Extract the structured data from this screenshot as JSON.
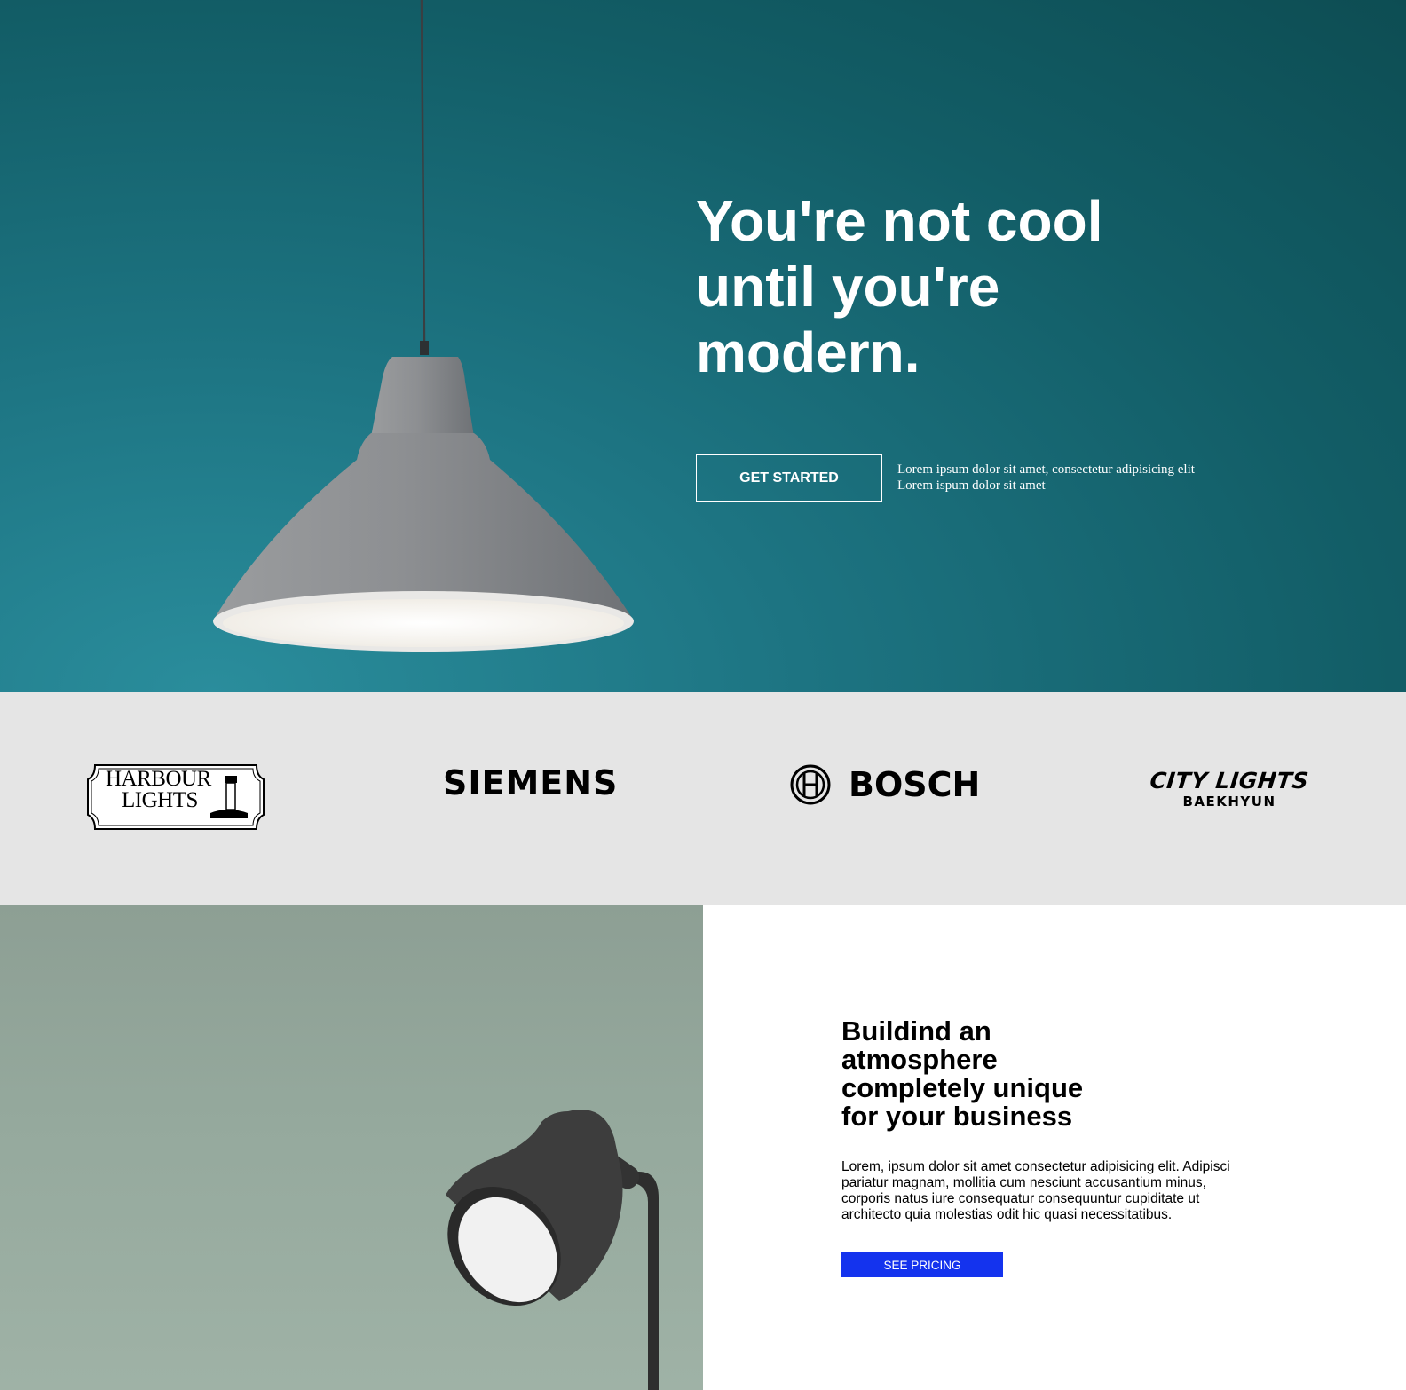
{
  "hero": {
    "title_line1": "You're not cool",
    "title_line2": "until you're",
    "title_line3": "modern.",
    "cta_label": "GET STARTED",
    "note_line1": "Lorem ipsum dolor sit amet, consectetur adipisicing elit",
    "note_line2": "Lorem ispum dolor sit amet",
    "image": "pendant-lamp-photo"
  },
  "logos": {
    "harbour_line1": "HARBOUR",
    "harbour_line2": "LIGHTS",
    "siemens": "SIEMENS",
    "bosch": "BOSCH",
    "citylights_main": "CITY LIGHTS",
    "citylights_sub": "BAEKHYUN"
  },
  "feature": {
    "heading": "Buildind an atmosphere completely unique for your business",
    "body": "Lorem, ipsum dolor sit amet consectetur adipisicing elit. Adipisci pariatur magnam, mollitia cum nesciunt accusantium minus, corporis natus iure consequatur consequuntur cupiditate ut architecto quia molestias odit hic quasi necessitatibus.",
    "button_label": "SEE PRICING",
    "image": "desk-lamp-photo"
  },
  "colors": {
    "hero_teal": "#125d66",
    "logo_strip_bg": "#e5e5e5",
    "feature_image_bg": "#95a99d",
    "pricing_button": "#1433ee"
  }
}
